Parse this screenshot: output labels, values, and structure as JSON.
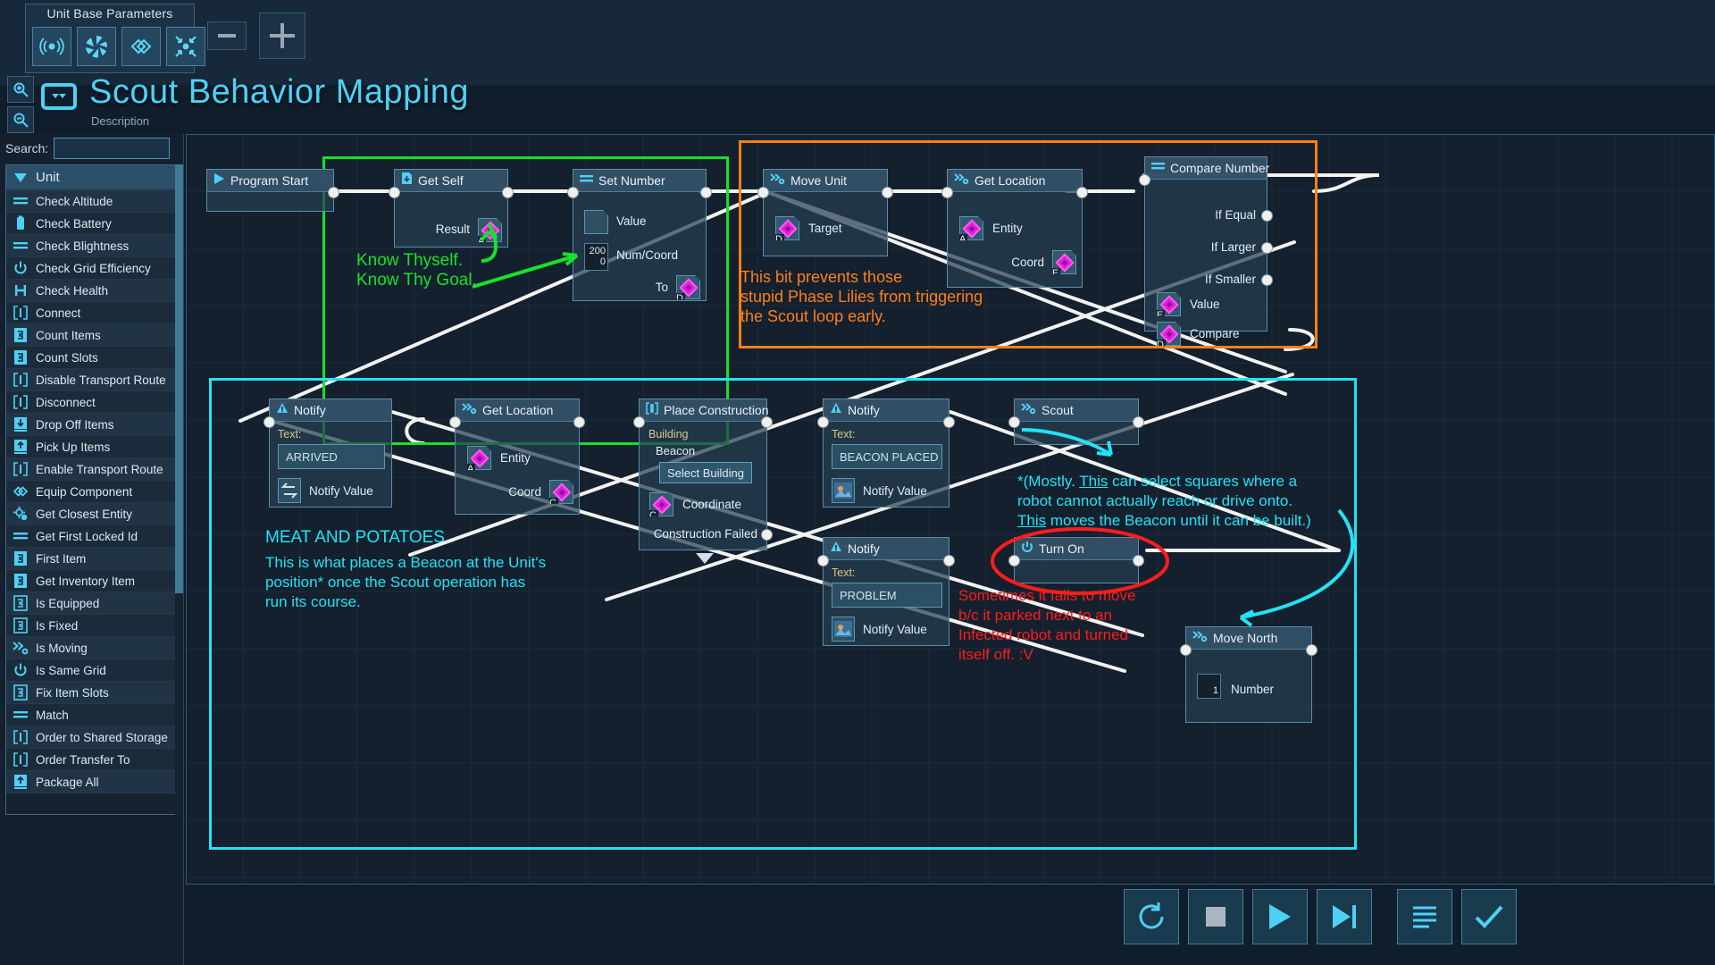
{
  "toolbar": {
    "panel_title": "Unit Base Parameters",
    "buttons": [
      {
        "name": "radar-icon",
        "label": "Radar"
      },
      {
        "name": "aperture-icon",
        "label": "Aperture"
      },
      {
        "name": "link-icon",
        "label": "Link"
      },
      {
        "name": "collapse-icon",
        "label": "Collapse"
      }
    ],
    "minus_label": "–",
    "plus_label": "+"
  },
  "header": {
    "title": "Scout Behavior Mapping",
    "description": "Description",
    "zoom_in": "+",
    "zoom_out": "–"
  },
  "sidebar": {
    "search_label": "Search:",
    "search_value": "",
    "search_placeholder": "",
    "items": [
      {
        "label": "Unit",
        "icon": "triangle-down-icon",
        "header": true
      },
      {
        "label": "Check Altitude",
        "icon": "equals-icon"
      },
      {
        "label": "Check Battery",
        "icon": "battery-icon"
      },
      {
        "label": "Check Blightness",
        "icon": "equals-icon"
      },
      {
        "label": "Check Grid Efficiency",
        "icon": "power-icon"
      },
      {
        "label": "Check Health",
        "icon": "health-icon"
      },
      {
        "label": "Connect",
        "icon": "bracket-icon"
      },
      {
        "label": "Count Items",
        "icon": "question-box-icon"
      },
      {
        "label": "Count Slots",
        "icon": "question-box-icon"
      },
      {
        "label": "Disable Transport Route",
        "icon": "bracket-icon"
      },
      {
        "label": "Disconnect",
        "icon": "bracket-icon"
      },
      {
        "label": "Drop Off Items",
        "icon": "arrow-down-icon"
      },
      {
        "label": "Pick Up Items",
        "icon": "arrow-up-icon"
      },
      {
        "label": "Enable Transport Route",
        "icon": "bracket-icon"
      },
      {
        "label": "Equip Component",
        "icon": "link-icon"
      },
      {
        "label": "Get Closest Entity",
        "icon": "target-pin-icon"
      },
      {
        "label": "Get First Locked Id",
        "icon": "equals-icon"
      },
      {
        "label": "First Item",
        "icon": "question-box-icon"
      },
      {
        "label": "Get Inventory Item",
        "icon": "question-box-icon"
      },
      {
        "label": "Is Equipped",
        "icon": "question-outline-icon"
      },
      {
        "label": "Is Fixed",
        "icon": "question-outline-icon"
      },
      {
        "label": "Is Moving",
        "icon": "chevrons-icon"
      },
      {
        "label": "Is Same Grid",
        "icon": "power-icon"
      },
      {
        "label": "Fix Item Slots",
        "icon": "question-outline-icon"
      },
      {
        "label": "Match",
        "icon": "equals-icon"
      },
      {
        "label": "Order to Shared Storage",
        "icon": "bracket-icon"
      },
      {
        "label": "Order Transfer To",
        "icon": "bracket-icon"
      },
      {
        "label": "Package All",
        "icon": "arrow-up-icon"
      }
    ]
  },
  "graph": {
    "nodes": {
      "program_start": {
        "title": "Program Start",
        "icon": "play-icon"
      },
      "get_self": {
        "title": "Get Self",
        "icon": "download-icon",
        "out_label": "Result",
        "out_letter": "A"
      },
      "set_number": {
        "title": "Set Number",
        "icon": "equals-icon",
        "value_label": "Value",
        "num_label": "Num/Coord",
        "num_value_1": "200",
        "num_value_2": "0",
        "to_label": "To",
        "to_letter": "D"
      },
      "move_unit": {
        "title": "Move Unit",
        "icon": "chevrons-icon",
        "target_label": "Target",
        "target_letter": "D"
      },
      "get_location_top": {
        "title": "Get Location",
        "icon": "chevrons-icon",
        "entity_label": "Entity",
        "entity_letter": "A",
        "coord_label": "Coord",
        "coord_letter": "E"
      },
      "compare_number": {
        "title": "Compare Number",
        "icon": "equals-icon",
        "if_equal": "If Equal",
        "if_larger": "If Larger",
        "if_smaller": "If Smaller",
        "value_label": "Value",
        "value_letter": "E",
        "compare_label": "Compare",
        "compare_letter": "D"
      },
      "notify_arrived": {
        "title": "Notify",
        "icon": "warning-icon",
        "text_caption": "Text:",
        "text_value": "ARRIVED",
        "notify_value_label": "Notify Value"
      },
      "get_location_bottom": {
        "title": "Get Location",
        "icon": "chevrons-icon",
        "entity_label": "Entity",
        "entity_letter": "A",
        "coord_label": "Coord",
        "coord_letter": "C"
      },
      "place_construction": {
        "title": "Place Construction",
        "icon": "bracket-icon",
        "building_caption": "Building",
        "building_value": "Beacon",
        "select_building": "Select Building",
        "coordinate_label": "Coordinate",
        "coordinate_letter": "C",
        "construction_failed": "Construction Failed"
      },
      "notify_beacon": {
        "title": "Notify",
        "icon": "warning-icon",
        "text_caption": "Text:",
        "text_value": "BEACON PLACED",
        "notify_value_label": "Notify Value"
      },
      "scout": {
        "title": "Scout",
        "icon": "chevrons-icon"
      },
      "notify_problem": {
        "title": "Notify",
        "icon": "warning-icon",
        "text_caption": "Text:",
        "text_value": "PROBLEM",
        "notify_value_label": "Notify Value"
      },
      "turn_on": {
        "title": "Turn On",
        "icon": "power-icon"
      },
      "move_north": {
        "title": "Move North",
        "icon": "chevrons-icon",
        "number_label": "Number",
        "number_value": "1"
      }
    },
    "annotations": {
      "green": "Know Thyself.\nKnow Thy Goal.",
      "orange": "This bit prevents those\nstupid Phase Lilies from triggering\nthe Scout loop early.",
      "cyan_meat_title": "MEAT AND POTATOES",
      "cyan_meat_body": "This is what places a Beacon at the Unit's\nposition* once the Scout operation has\nrun its course.",
      "cyan_scout_l1_a": "*(Mostly. ",
      "cyan_scout_l1_b": "This",
      "cyan_scout_l1_c": " can select squares where a",
      "cyan_scout_l2": "robot cannot actually reach or drive onto.",
      "cyan_scout_l3_a": "This",
      "cyan_scout_l3_b": " moves the Beacon until it can be built.)",
      "red": "Sometimes it fails to move\nb/c it parked next to an\nInfected robot and turned\nitself off. :V"
    },
    "colors": {
      "green": "#16e02a",
      "orange": "#ff7f19",
      "cyan": "#22e3f5",
      "red": "#fc1c1c",
      "accent": "#4fd0f5",
      "slot_magenta": "#e31ce0"
    }
  },
  "bottom_bar": {
    "buttons": [
      {
        "name": "restart-button",
        "icon": "restart-icon"
      },
      {
        "name": "stop-button",
        "icon": "stop-icon"
      },
      {
        "name": "play-button",
        "icon": "play-icon"
      },
      {
        "name": "step-button",
        "icon": "step-icon"
      },
      {
        "name": "list-button",
        "icon": "list-icon"
      },
      {
        "name": "confirm-button",
        "icon": "check-icon"
      }
    ]
  }
}
